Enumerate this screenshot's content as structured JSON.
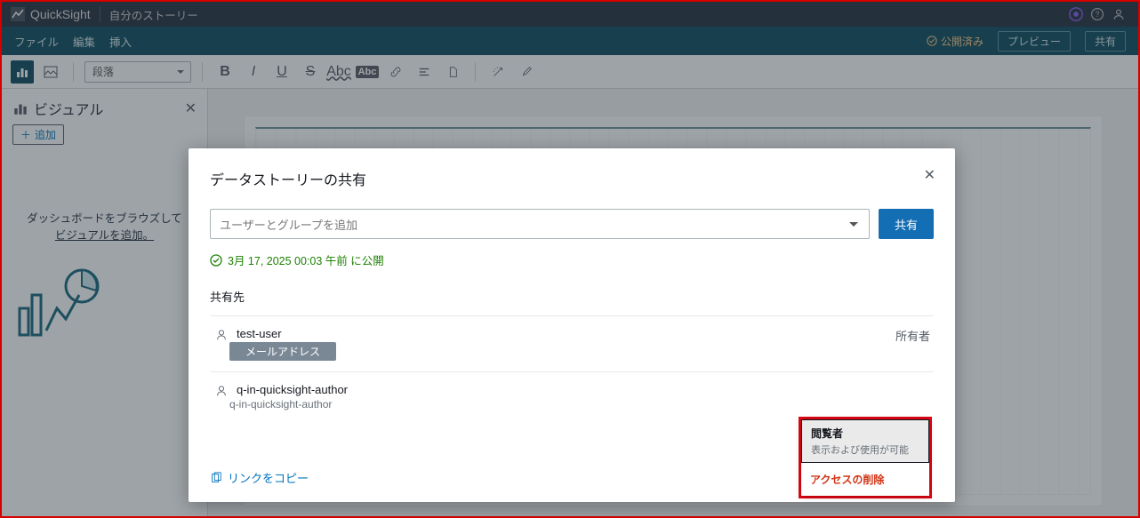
{
  "topbar": {
    "app_name": "QuickSight",
    "doc_title": "自分のストーリー"
  },
  "menubar": {
    "file": "ファイル",
    "edit": "編集",
    "insert": "挿入",
    "publish_status": "公開済み",
    "preview": "プレビュー",
    "share": "共有"
  },
  "toolbar": {
    "style_select": "段落"
  },
  "sidebar": {
    "title": "ビジュアル",
    "add_label": "追加",
    "hint_line1": "ダッシュボードをブラウズして",
    "hint_link": "ビジュアルを追加。"
  },
  "modal": {
    "title": "データストーリーの共有",
    "placeholder": "ユーザーとグループを追加",
    "share_btn": "共有",
    "publish_date": "3月 17, 2025 00:03 午前",
    "publish_suffix": "に公開",
    "shared_with": "共有先",
    "users": [
      {
        "name": "test-user",
        "email_label": "メールアドレス",
        "role": "所有者",
        "obscured": true
      },
      {
        "name": "q-in-quicksight-author",
        "email_label": "q-in-quicksight-author",
        "role": "",
        "obscured": false
      }
    ],
    "copy_link": "リンクをコピー"
  },
  "dropdown": {
    "viewer": "閲覧者",
    "viewer_desc": "表示および使用が可能",
    "remove": "アクセスの削除"
  }
}
